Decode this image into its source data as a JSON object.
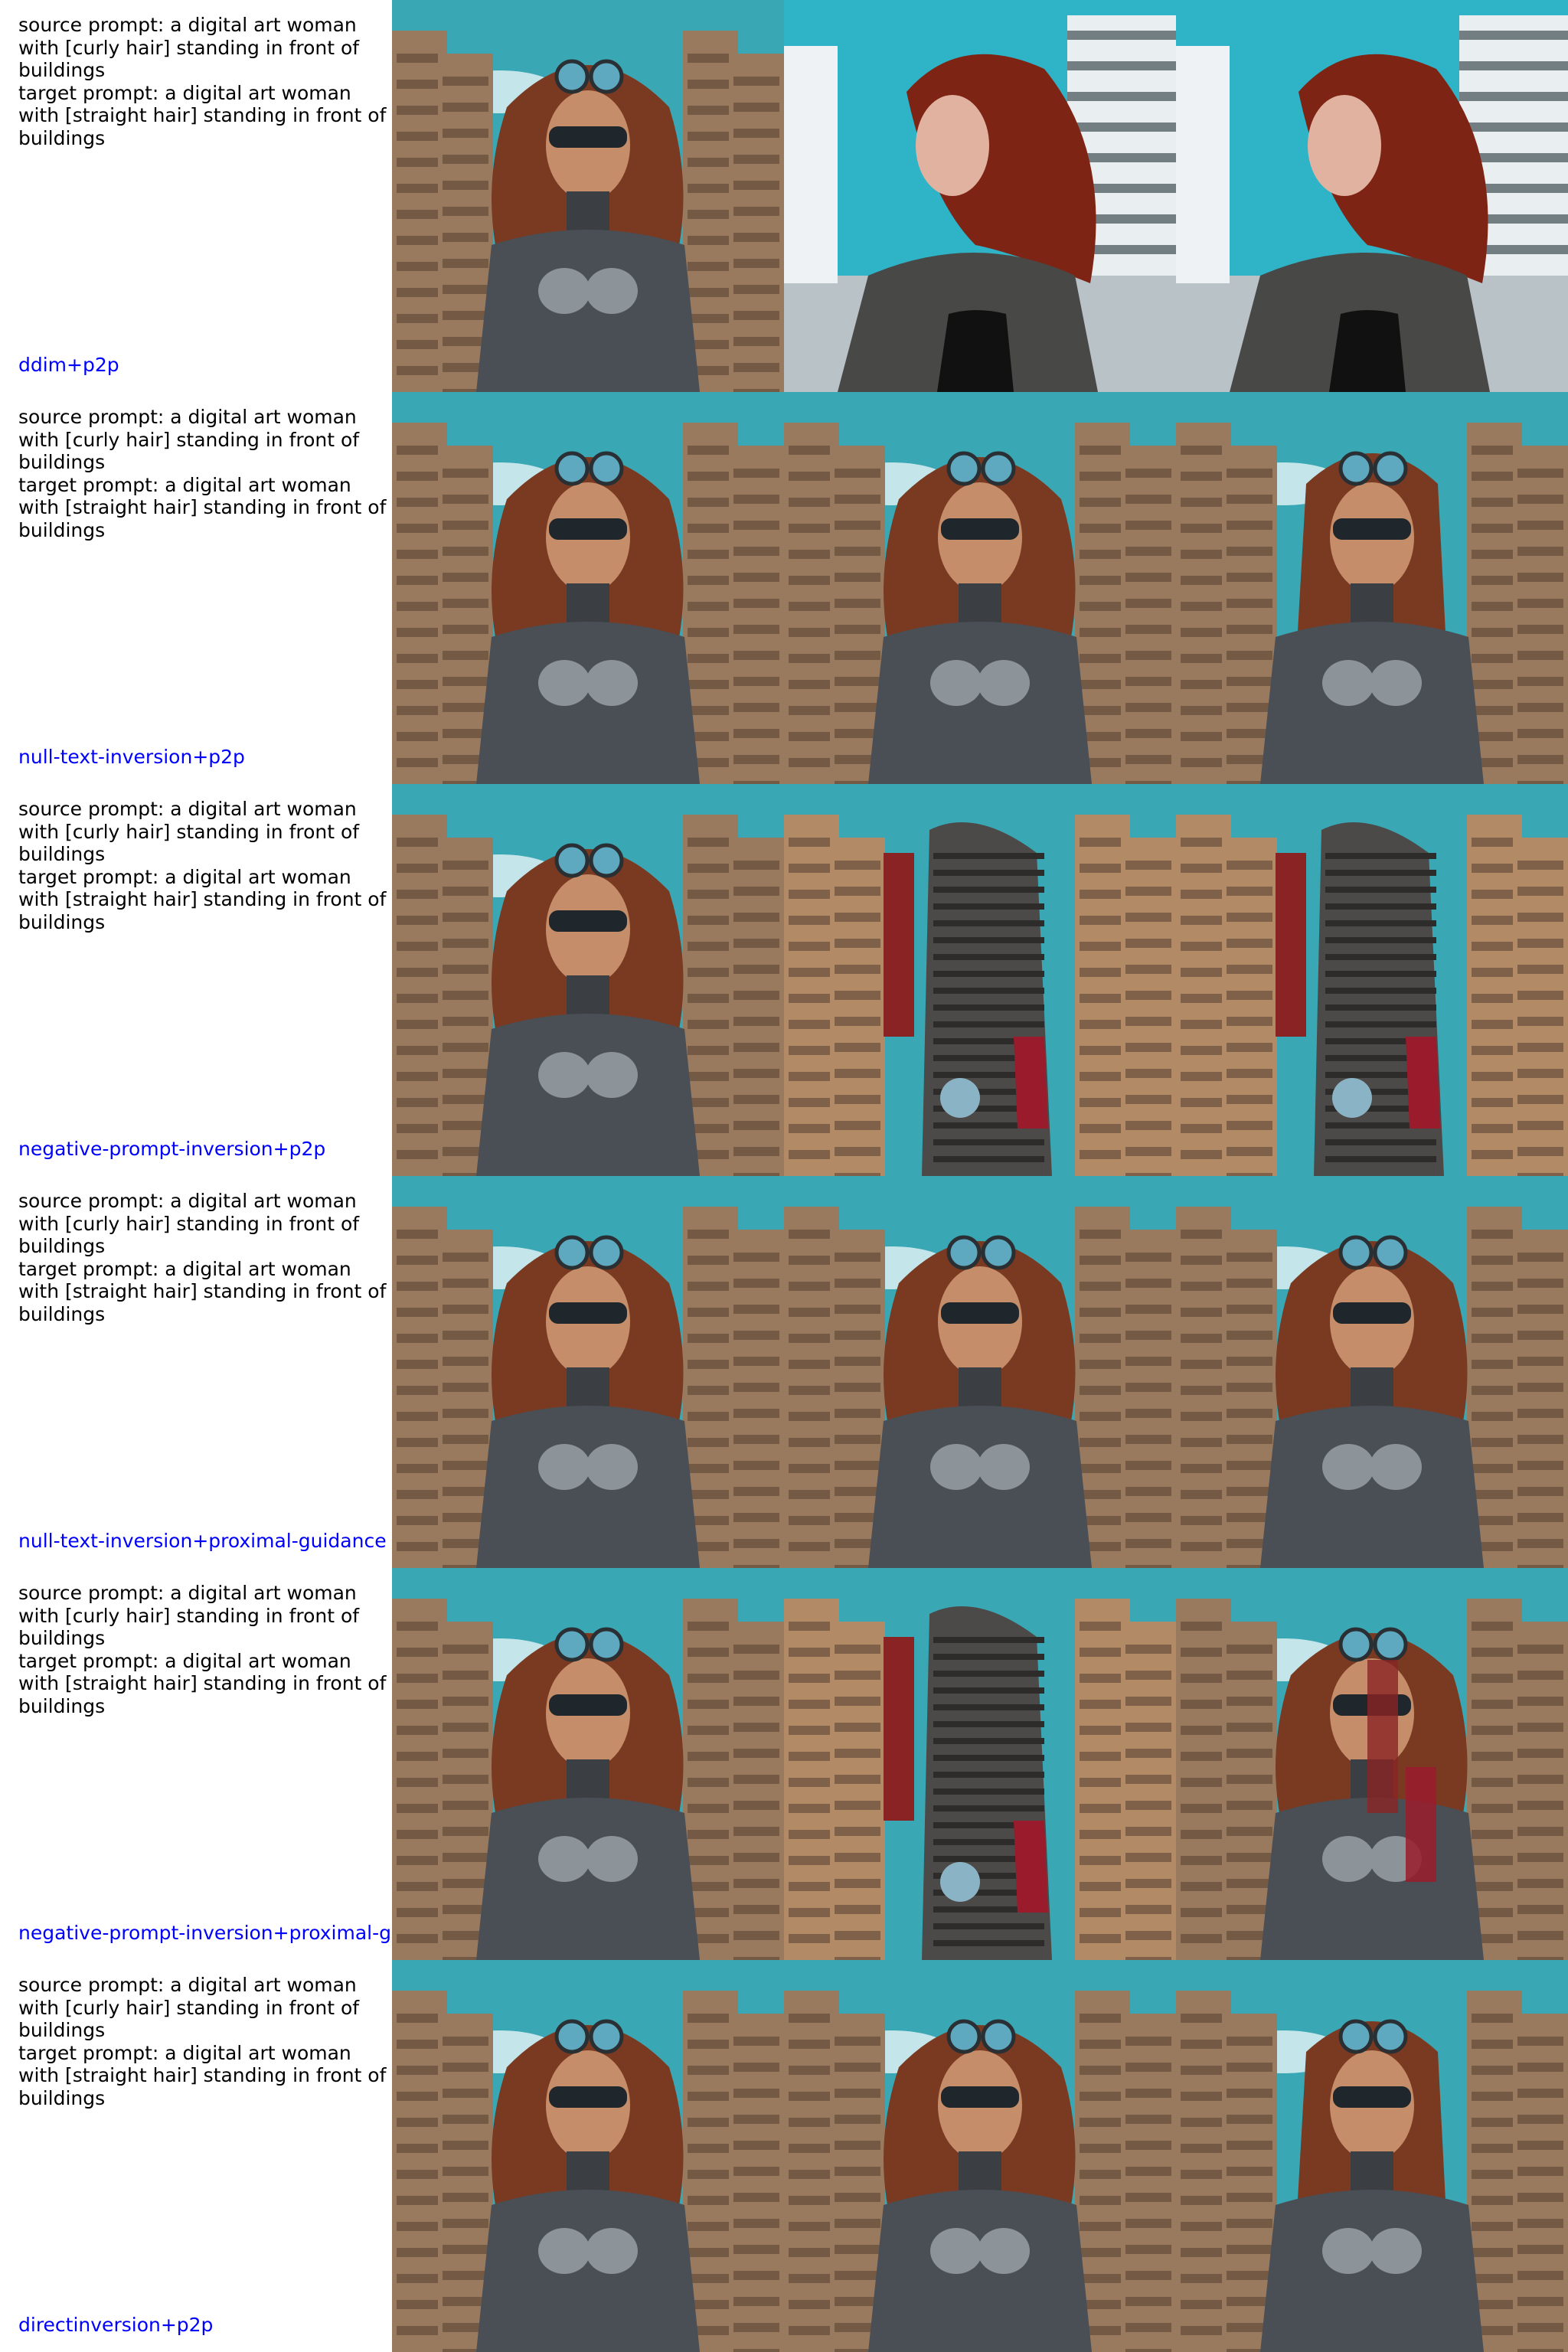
{
  "rows": [
    {
      "source_prompt": "source prompt: a digital art woman with [curly hair] standing in front of buildings",
      "target_prompt": "target prompt: a digital art woman with [straight hair] standing in front of buildings",
      "method": "ddim+p2p",
      "images": [
        "armored-woman-source",
        "curly-red-haired-woman-photo",
        "curly-red-haired-woman-photo"
      ]
    },
    {
      "source_prompt": "source prompt: a digital art woman with [curly hair] standing in front of buildings",
      "target_prompt": "target prompt: a digital art woman with [straight hair] standing in front of buildings",
      "method": "null-text-inversion+p2p",
      "images": [
        "armored-woman-source",
        "armored-woman-reconstruction",
        "armored-woman-straight-hair"
      ]
    },
    {
      "source_prompt": "source prompt: a digital art woman with [curly hair] standing in front of buildings",
      "target_prompt": "target prompt: a digital art woman with [straight hair] standing in front of buildings",
      "method": "negative-prompt-inversion+p2p",
      "images": [
        "armored-woman-source",
        "tower-building-collapse",
        "tower-building-collapse"
      ]
    },
    {
      "source_prompt": "source prompt: a digital art woman with [curly hair] standing in front of buildings",
      "target_prompt": "target prompt: a digital art woman with [straight hair] standing in front of buildings",
      "method": "null-text-inversion+proximal-guidance",
      "images": [
        "armored-woman-source",
        "armored-woman-reconstruction",
        "armored-woman-curly-hair"
      ]
    },
    {
      "source_prompt": "source prompt: a digital art woman with [curly hair] standing in front of buildings",
      "target_prompt": "target prompt: a digital art woman with [straight hair] standing in front of buildings",
      "method": "negative-prompt-inversion+proximal-g",
      "images": [
        "armored-woman-source",
        "tower-building-collapse",
        "armored-woman-distorted"
      ]
    },
    {
      "source_prompt": "source prompt: a digital art woman with [curly hair] standing in front of buildings",
      "target_prompt": "target prompt: a digital art woman with [straight hair] standing in front of buildings",
      "method": "directinversion+p2p",
      "images": [
        "armored-woman-source",
        "armored-woman-reconstruction",
        "woman-long-straight-hair"
      ]
    }
  ],
  "colors": {
    "method_label": "#0000ff",
    "prompt_text": "#000000",
    "sky": "#3aa7b5",
    "building": "#9a7a5e",
    "hair": "#7a3a22",
    "armor": "#4a4f55"
  }
}
